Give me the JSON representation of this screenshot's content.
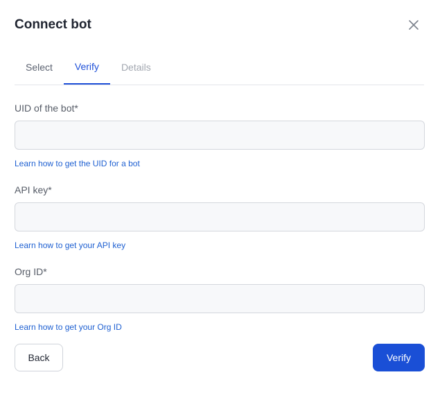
{
  "dialog": {
    "title": "Connect bot",
    "close_icon": "close-icon"
  },
  "tabs": [
    {
      "label": "Select",
      "state": "default"
    },
    {
      "label": "Verify",
      "state": "active"
    },
    {
      "label": "Details",
      "state": "disabled"
    }
  ],
  "fields": [
    {
      "label": "UID of the bot*",
      "value": "",
      "placeholder": "",
      "help_link": "Learn how to get the UID for a bot"
    },
    {
      "label": "API key*",
      "value": "",
      "placeholder": "",
      "help_link": "Learn how to get your API key"
    },
    {
      "label": "Org ID*",
      "value": "",
      "placeholder": "",
      "help_link": "Learn how to get your Org ID"
    }
  ],
  "actions": {
    "back_label": "Back",
    "verify_label": "Verify"
  },
  "colors": {
    "accent": "#1a4fd6",
    "link": "#1d5fd1",
    "tab_active": "#1d4fd8",
    "input_bg": "#f7f8fa",
    "input_border": "#d4d7dd"
  }
}
